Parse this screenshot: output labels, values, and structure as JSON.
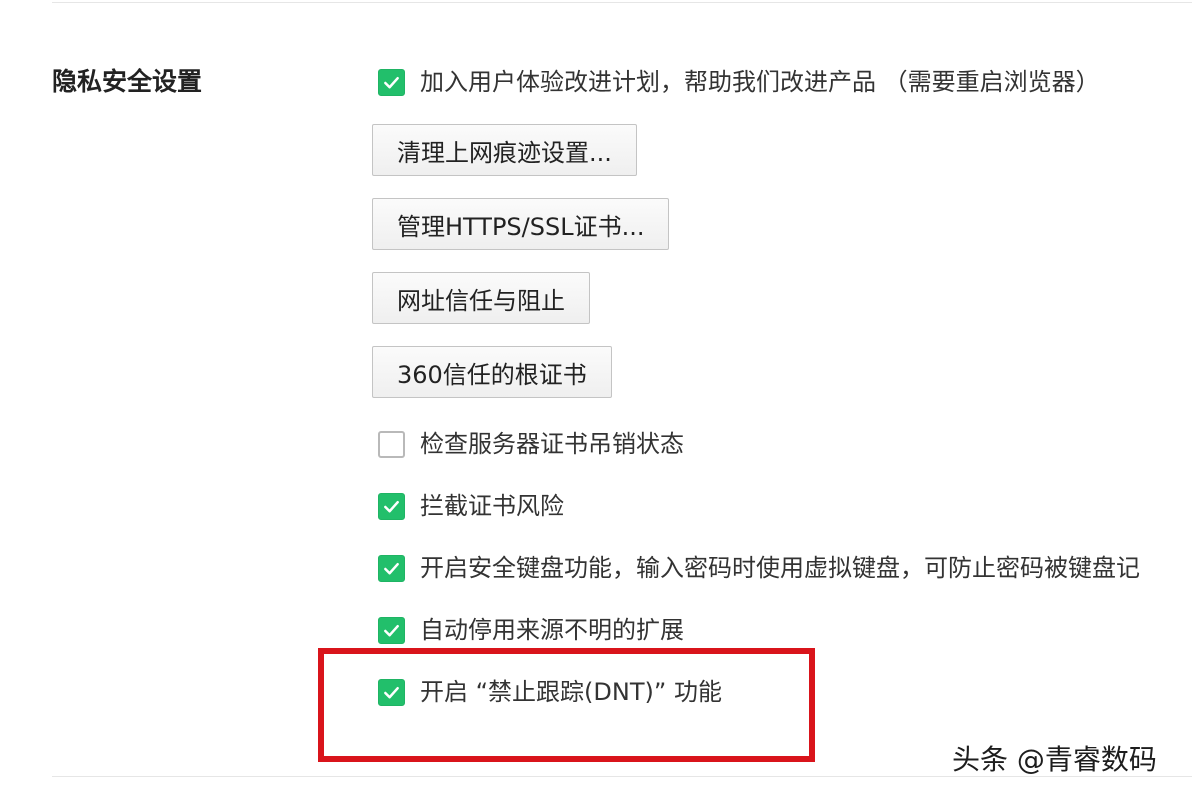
{
  "section": {
    "title": "隐私安全设置"
  },
  "options": {
    "improvement_plan": {
      "label": "加入用户体验改进计划，帮助我们改进产品 （需要重启浏览器）",
      "checked": true
    },
    "check_revocation": {
      "label": "检查服务器证书吊销状态",
      "checked": false
    },
    "block_cert_risk": {
      "label": "拦截证书风险",
      "checked": true
    },
    "secure_keyboard": {
      "label": "开启安全键盘功能，输入密码时使用虚拟键盘，可防止密码被键盘记",
      "checked": true
    },
    "disable_unknown_ext": {
      "label": "自动停用来源不明的扩展",
      "checked": true
    },
    "dnt": {
      "label": "开启 “禁止跟踪(DNT)” 功能",
      "checked": true
    }
  },
  "buttons": {
    "clear_traces": "清理上网痕迹设置...",
    "manage_certs": "管理HTTPS/SSL证书...",
    "url_trust": "网址信任与阻止",
    "root_certs": "360信任的根证书"
  },
  "watermark": "头条 @青睿数码",
  "colors": {
    "checkbox_checked": "#22bf6b",
    "highlight": "#d9141b"
  }
}
